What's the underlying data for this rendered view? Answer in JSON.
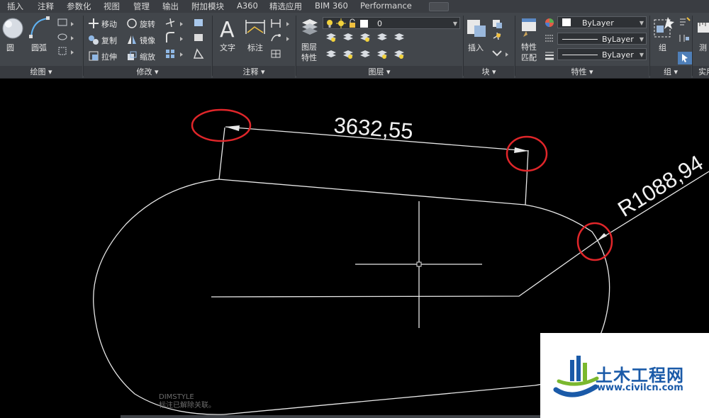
{
  "menu_tabs": [
    "插入",
    "注释",
    "参数化",
    "视图",
    "管理",
    "输出",
    "附加模块",
    "A360",
    "精选应用",
    "BIM 360",
    "Performance"
  ],
  "ribbon": {
    "draw": {
      "title": "绘图",
      "circle": "圆",
      "arc": "圆弧"
    },
    "modify": {
      "title": "修改",
      "move": "移动",
      "rotate": "旋转",
      "copy": "复制",
      "mirror": "镜像",
      "stretch": "拉伸",
      "scale": "缩放"
    },
    "annotation": {
      "title": "注释",
      "text": "文字",
      "dimension": "标注"
    },
    "layers": {
      "title": "图层",
      "layer_props_1": "图层",
      "layer_props_2": "特性",
      "current_layer": "0"
    },
    "block": {
      "title": "块",
      "insert": "插入"
    },
    "properties": {
      "title": "特性",
      "match_1": "特性",
      "match_2": "匹配",
      "color": "ByLayer",
      "linetype": "ByLayer",
      "lineweight": "ByLayer"
    },
    "groups": {
      "title": "组",
      "group": "组"
    },
    "utilities": {
      "title": "实用",
      "measure": "测"
    }
  },
  "drawing": {
    "dimension_linear": "3632,55",
    "dimension_radius": "R1088,94"
  },
  "command_line": {
    "line1": "DIMSTYLE",
    "line2": "标注已解除关联。"
  },
  "watermark": {
    "name": "土木工程网",
    "url": "www.civilcn.com"
  },
  "colors": {
    "ribbon_bg": "#42464b",
    "tab_bg": "#3a3d42",
    "highlight_circle": "#e0262a",
    "logo_blue": "#1a5aa8",
    "logo_green": "#7ab82e"
  }
}
